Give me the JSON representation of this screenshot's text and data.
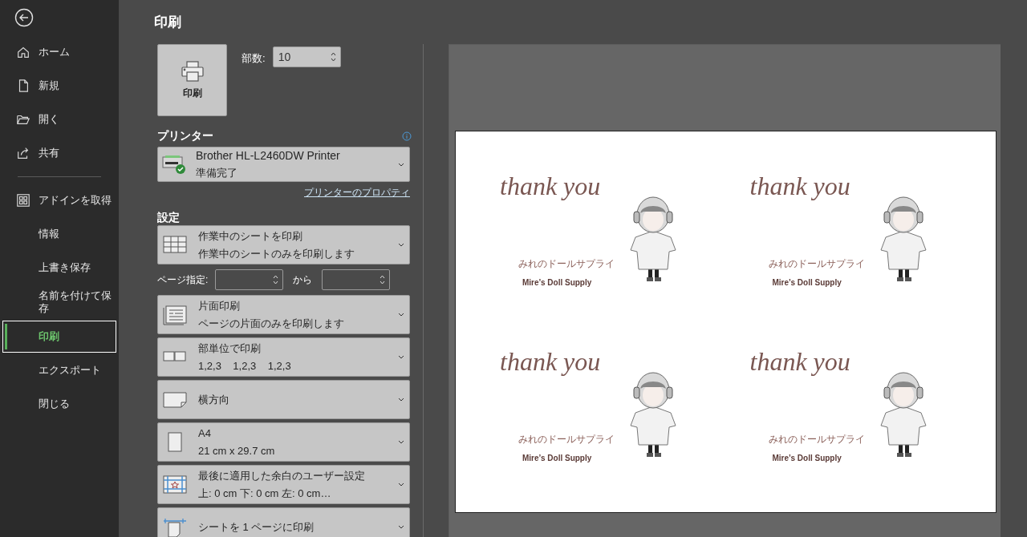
{
  "sidebar": {
    "groups": [
      [
        {
          "label": "ホーム",
          "kind": "home",
          "selected": false
        },
        {
          "label": "新規",
          "kind": "new",
          "selected": false
        },
        {
          "label": "開く",
          "kind": "open",
          "selected": false
        },
        {
          "label": "共有",
          "kind": "share",
          "selected": false
        }
      ],
      [
        {
          "label": "アドインを取得",
          "kind": "addins",
          "selected": false
        },
        {
          "label": "情報",
          "kind": "text",
          "selected": false
        },
        {
          "label": "上書き保存",
          "kind": "text",
          "selected": false
        },
        {
          "label": "名前を付けて保存",
          "kind": "text",
          "selected": false
        },
        {
          "label": "印刷",
          "kind": "text",
          "selected": true
        },
        {
          "label": "エクスポート",
          "kind": "text",
          "selected": false
        },
        {
          "label": "閉じる",
          "kind": "text",
          "selected": false
        }
      ]
    ]
  },
  "title": "印刷",
  "print_button": {
    "label": "印刷"
  },
  "copies": {
    "label": "部数:",
    "value": "10"
  },
  "printer": {
    "heading": "プリンター",
    "name": "Brother HL-L2460DW Printer",
    "status": "準備完了",
    "properties_link": "プリンターのプロパティ"
  },
  "settings": {
    "heading": "設定",
    "items": [
      {
        "kind": "sheet",
        "title": "作業中のシートを印刷",
        "subtitle": "作業中のシートのみを印刷します"
      },
      {
        "kind": "range",
        "label": "ページ指定:",
        "to_label": "から"
      },
      {
        "kind": "single",
        "title": "片面印刷",
        "subtitle": "ページの片面のみを印刷します"
      },
      {
        "kind": "collate",
        "title": "部単位で印刷",
        "subtitle": "1,2,3    1,2,3    1,2,3"
      },
      {
        "kind": "landscape",
        "title": "横方向"
      },
      {
        "kind": "portrait",
        "title": "A4",
        "subtitle": "21 cm x 29.7 cm"
      },
      {
        "kind": "margins",
        "title": "最後に適用した余白のユーザー設定",
        "subtitle": "上: 0 cm 下: 0 cm 左: 0 cm…"
      },
      {
        "kind": "fit",
        "title": "シートを 1 ページに印刷"
      }
    ]
  },
  "preview": {
    "cards": [
      {
        "greeting": "thank you",
        "name_jp": "みれのドールサプライ",
        "name_en": "Mire’s Doll Supply"
      },
      {
        "greeting": "thank you",
        "name_jp": "みれのドールサプライ",
        "name_en": "Mire’s Doll Supply"
      },
      {
        "greeting": "thank you",
        "name_jp": "みれのドールサプライ",
        "name_en": "Mire’s Doll Supply"
      },
      {
        "greeting": "thank you",
        "name_jp": "みれのドールサプライ",
        "name_en": "Mire’s Doll Supply"
      }
    ]
  }
}
